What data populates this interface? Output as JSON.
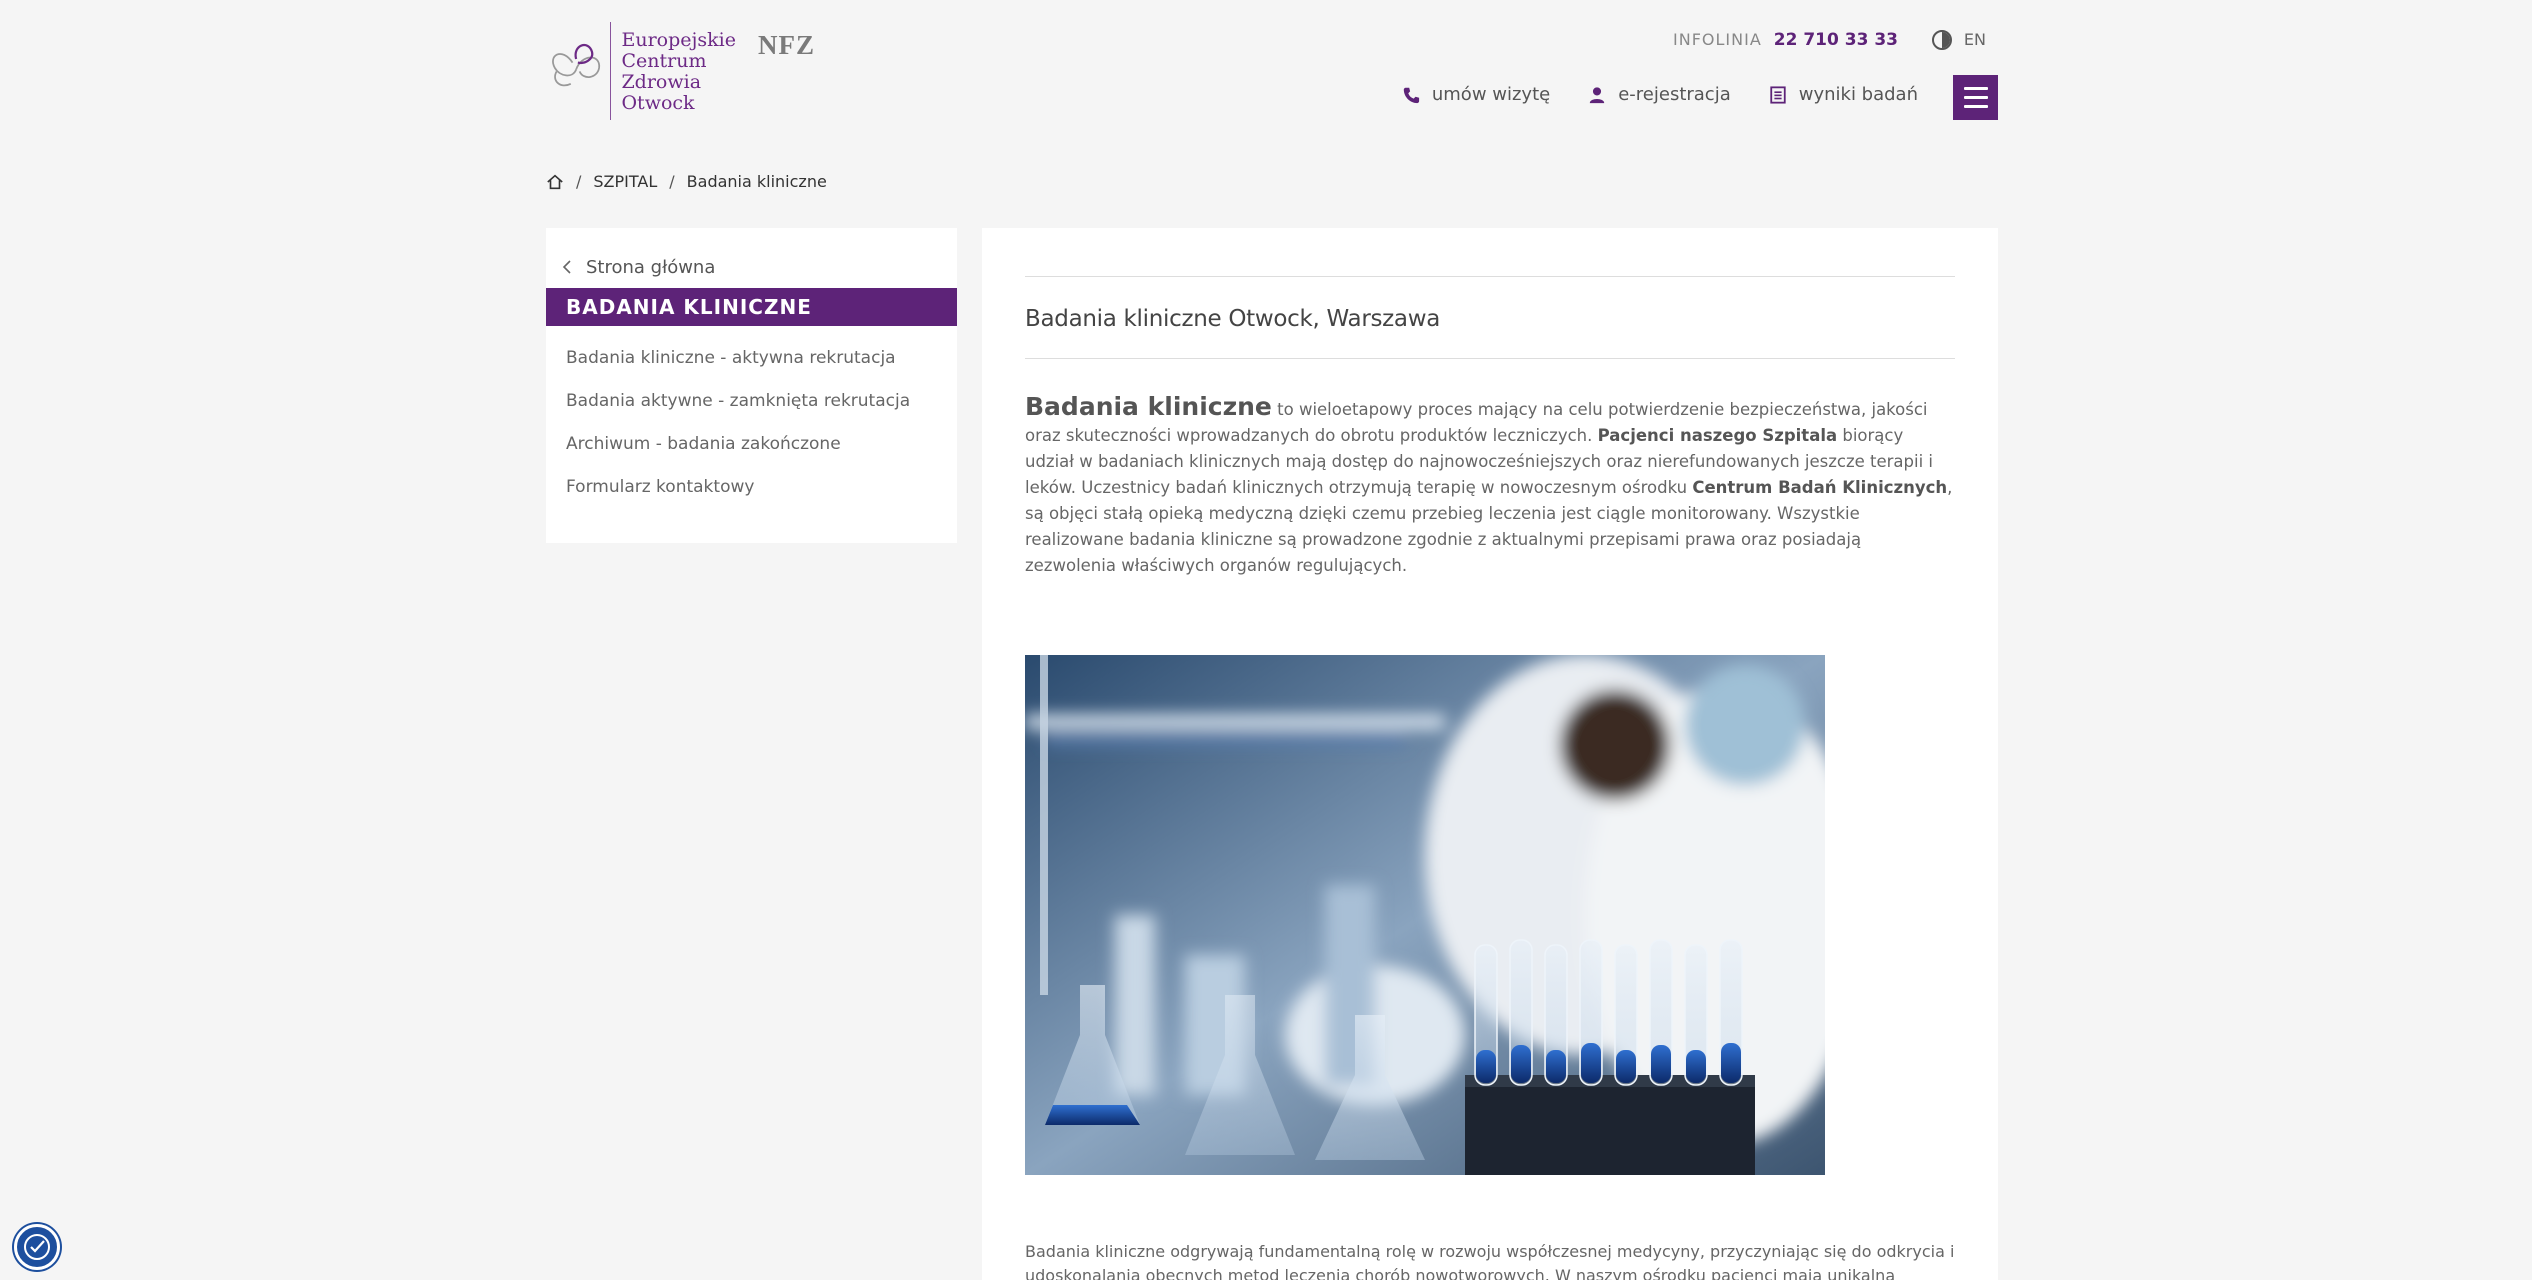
{
  "header": {
    "logo_lines": [
      "Europejskie",
      "Centrum",
      "Zdrowia",
      "Otwock"
    ],
    "nfz_label": "NFZ",
    "infoline_label": "INFOLINIA",
    "infoline_phone": "22 710 33 33",
    "contrast_icon": "contrast-icon",
    "lang_label": "EN",
    "quicklinks": [
      {
        "label": "umów wizytę",
        "icon": "phone-icon"
      },
      {
        "label": "e-rejestracja",
        "icon": "user-icon"
      },
      {
        "label": "wyniki badań",
        "icon": "document-icon"
      }
    ],
    "menu_icon": "hamburger-icon"
  },
  "breadcrumb": {
    "home_icon": "home-icon",
    "items": [
      "SZPITAL",
      "Badania kliniczne"
    ],
    "separator": "/"
  },
  "sidebar": {
    "back_label": "Strona główna",
    "title": "BADANIA KLINICZNE",
    "items": [
      "Badania kliniczne - aktywna rekrutacja",
      "Badania aktywne - zamknięta rekrutacja",
      "Archiwum - badania zakończone",
      "Formularz kontaktowy"
    ]
  },
  "main": {
    "title": "Badania kliniczne Otwock, Warszawa",
    "intro": {
      "lead": "Badania kliniczne",
      "t1": " to wieloetapowy proces mający na celu potwierdzenie bezpieczeństwa, jakości oraz skuteczności wprowadzanych do obrotu produktów leczniczych. ",
      "b1": "Pacjenci naszego Szpitala",
      "t2": " biorący udział w badaniach klinicznych mają dostęp do najnowocześniejszych oraz nierefundowanych jeszcze terapii i leków. Uczestnicy badań klinicznych otrzymują terapię w nowoczesnym ośrodku ",
      "b2": "Centrum Badań Klinicznych",
      "t3": ", są objęci stałą opieką medyczną dzięki czemu przebieg leczenia jest ciągle monitorowany. Wszystkie realizowane badania kliniczne są prowadzone zgodnie z aktualnymi przepisami prawa oraz posiadają zezwolenia właściwych organów regulujących."
    },
    "paragraph2": "Badania kliniczne odgrywają fundamentalną rolę w rozwoju współczesnej medycyny, przyczyniając się do odkrycia i udoskonalania obecnych metod leczenia chorób nowotworowych. W naszym ośrodku pacjenci mają unikalną szansę"
  },
  "colors": {
    "brand_purple": "#5d2378",
    "background": "#f5f5f5",
    "a11y_blue": "#1d4f9e"
  }
}
